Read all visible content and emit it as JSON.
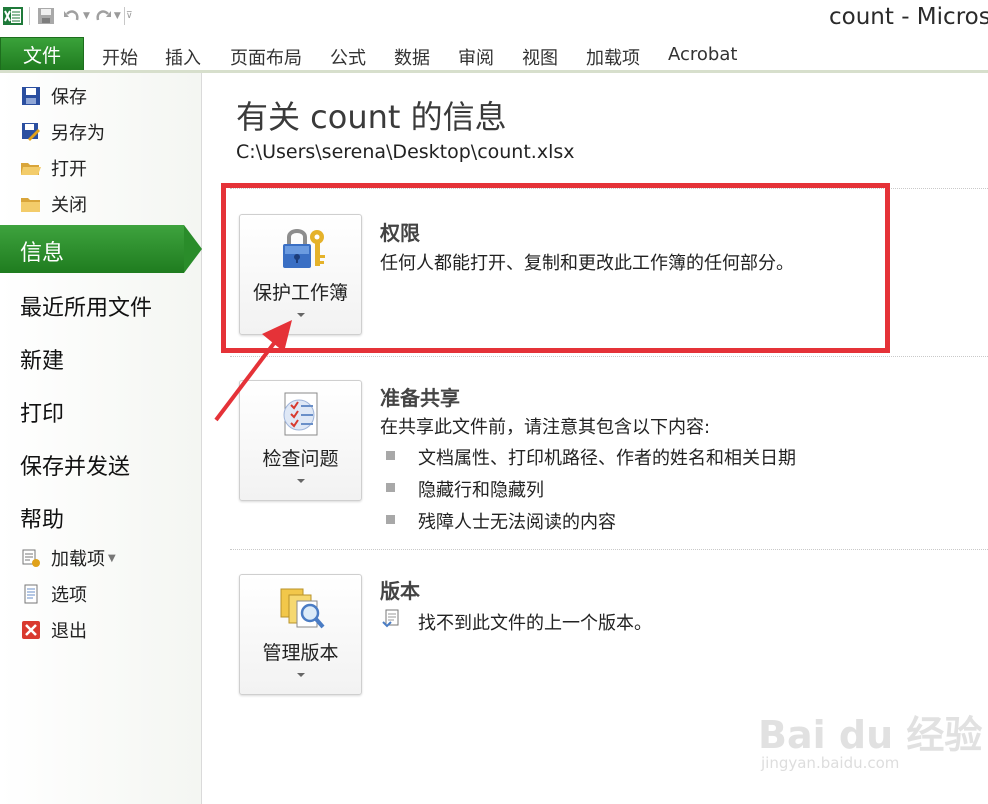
{
  "window": {
    "title": "count - Micros"
  },
  "ribbon": {
    "file_tab": "文件",
    "tabs": [
      "开始",
      "插入",
      "页面布局",
      "公式",
      "数据",
      "审阅",
      "视图",
      "加载项",
      "Acrobat"
    ]
  },
  "backstage_nav": {
    "top_items": [
      {
        "label": "保存",
        "icon": "save-icon"
      },
      {
        "label": "另存为",
        "icon": "save-as-icon"
      },
      {
        "label": "打开",
        "icon": "open-folder-icon"
      },
      {
        "label": "关闭",
        "icon": "close-folder-icon"
      }
    ],
    "selected": "信息",
    "big_items": [
      "最近所用文件",
      "新建",
      "打印",
      "保存并发送",
      "帮助"
    ],
    "bottom_items": [
      {
        "label": "加载项",
        "icon": "addins-icon"
      },
      {
        "label": "选项",
        "icon": "options-icon"
      },
      {
        "label": "退出",
        "icon": "exit-icon"
      }
    ]
  },
  "info": {
    "title": "有关 count 的信息",
    "path": "C:\\Users\\serena\\Desktop\\count.xlsx",
    "sections": [
      {
        "button_label": "保护工作簿",
        "title": "权限",
        "description": "任何人都能打开、复制和更改此工作簿的任何部分。",
        "icon": "lock-key-icon"
      },
      {
        "button_label": "检查问题",
        "title": "准备共享",
        "description": "在共享此文件前，请注意其包含以下内容:",
        "bullets": [
          "文档属性、打印机路径、作者的姓名和相关日期",
          "隐藏行和隐藏列",
          "残障人士无法阅读的内容"
        ],
        "icon": "checklist-icon"
      },
      {
        "button_label": "管理版本",
        "title": "版本",
        "description": "找不到此文件的上一个版本。",
        "icon": "versions-icon"
      }
    ]
  },
  "watermark": {
    "text": "Bai du 经验",
    "sub": "jingyan.baidu.com"
  },
  "colors": {
    "file_green": "#2a8c2a",
    "annotation_red": "#e53238"
  }
}
